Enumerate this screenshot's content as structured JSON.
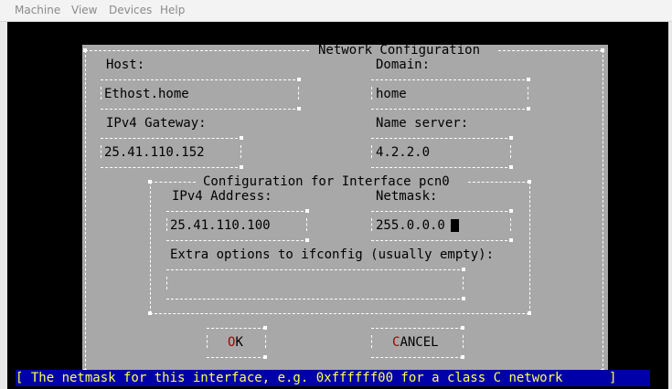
{
  "menu": {
    "items": [
      "Machine",
      "View",
      "Devices",
      "Help"
    ]
  },
  "dialog": {
    "title": "Network Configuration",
    "host_label": "Host:",
    "host_value": "Ethost.home",
    "domain_label": "Domain:",
    "domain_value": "home",
    "gateway_label": "IPv4 Gateway:",
    "gateway_value": "25.41.110.152",
    "nameserver_label": "Name server:",
    "nameserver_value": "4.2.2.0",
    "interface_title": "Configuration for Interface pcn0",
    "ipv4_label": "IPv4 Address:",
    "ipv4_value": "25.41.110.100",
    "netmask_label": "Netmask:",
    "netmask_value": "255.0.0.0",
    "extra_label": "Extra options to ifconfig (usually empty):",
    "extra_value": "",
    "ok_hotkey": "O",
    "ok_rest": "K",
    "cancel_hotkey": "C",
    "cancel_rest": "ANCEL"
  },
  "status": {
    "text": "[ The netmask for this interface, e.g. 0xffffff00 for a class C network      ]"
  },
  "colors": {
    "dialog_bg": "#a8a8a8",
    "hotkey": "#a40000",
    "status_bg": "#0000a8",
    "status_fg": "#ffff55"
  }
}
